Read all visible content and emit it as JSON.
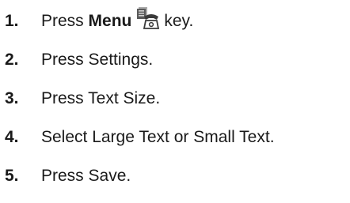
{
  "steps": [
    {
      "number": "1.",
      "before": "Press ",
      "bold": "Menu",
      "after": "key.",
      "icon": "menu-key-icon"
    },
    {
      "number": "2.",
      "text": "Press Settings."
    },
    {
      "number": "3.",
      "text": "Press Text Size."
    },
    {
      "number": "4.",
      "text": "Select Large Text or Small Text."
    },
    {
      "number": "5.",
      "text": "Press Save."
    }
  ]
}
